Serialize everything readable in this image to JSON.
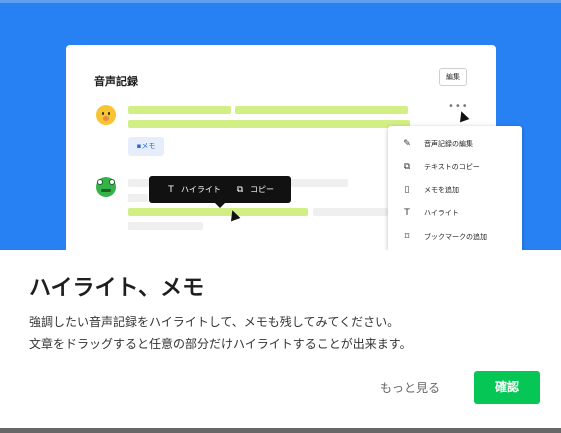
{
  "hero": {
    "card_title": "音声記録",
    "edit_label": "編集",
    "memo_chip_label": "メモ",
    "more_dots": "•••",
    "tooltip": {
      "highlight_label": "ハイライト",
      "copy_label": "コピー"
    },
    "context_menu": [
      {
        "icon": "pencil-icon",
        "glyph": "✎",
        "label": "音声記録の編集"
      },
      {
        "icon": "copy-icon",
        "glyph": "⧉",
        "label": "テキストのコピー"
      },
      {
        "icon": "note-icon",
        "glyph": "▯",
        "label": "メモを追加"
      },
      {
        "icon": "text-highlight-icon",
        "glyph": "T",
        "label": "ハイライト"
      },
      {
        "icon": "bookmark-icon",
        "glyph": "⌑",
        "label": "ブックマークの追加"
      }
    ]
  },
  "dialog": {
    "title": "ハイライト、メモ",
    "description_line1": "強調したい音声記録をハイライトして、メモも残してみてください。",
    "description_line2": "文章をドラッグすると任意の部分だけハイライトすることが出来ます。",
    "more_label": "もっと見る",
    "confirm_label": "確認"
  },
  "colors": {
    "hero_background": "#2881f2",
    "highlight": "#d2ef86",
    "accent_green": "#06c755",
    "memo_chip_text": "#2a66e3"
  }
}
